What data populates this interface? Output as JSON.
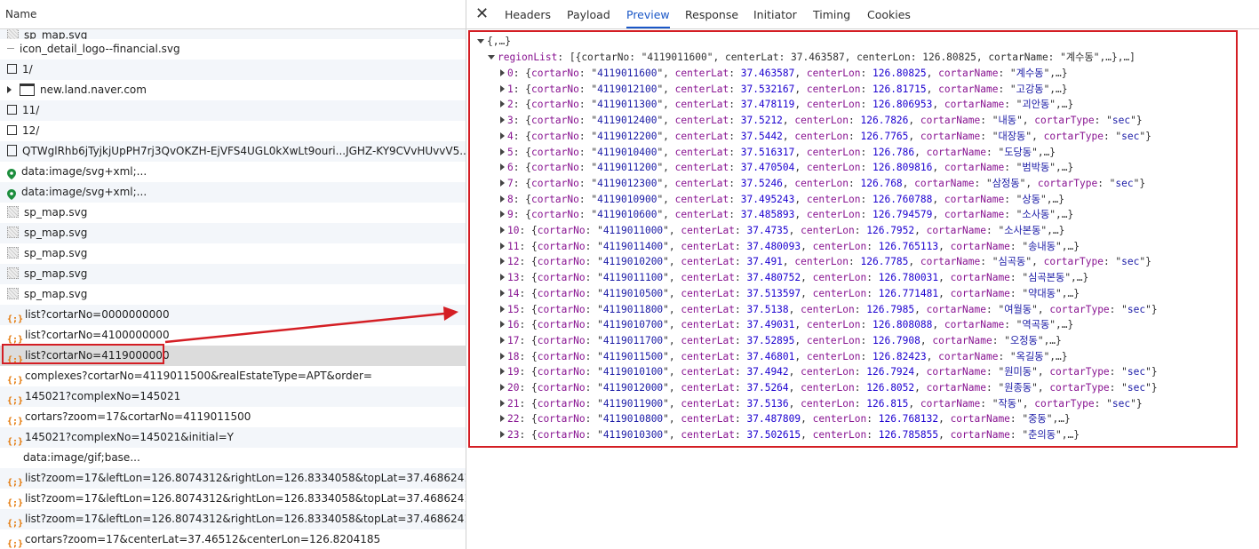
{
  "left_panel": {
    "column_header": "Name",
    "requests": [
      {
        "label": "sp_map.svg",
        "icon": "svg-image-icon"
      },
      {
        "label": "icon_detail_logo--financial.svg",
        "icon": "dash-icon"
      },
      {
        "label": "1/",
        "icon": "document-icon"
      },
      {
        "label": "new.land.naver.com",
        "icon": "frame-icon"
      },
      {
        "label": "11/",
        "icon": "document-icon"
      },
      {
        "label": "12/",
        "icon": "document-icon"
      },
      {
        "label": "QTWglRhb6jTyjkjUpPH7rj3QvOKZH-EjVFS4UGL0kXwLt9ouri...JGHZ-KY9CVvHUvvV5...",
        "icon": "file-icon"
      },
      {
        "label": "data:image/svg+xml;...",
        "icon": "map-pin-icon"
      },
      {
        "label": "data:image/svg+xml;...",
        "icon": "map-pin-icon"
      },
      {
        "label": "sp_map.svg",
        "icon": "svg-image-icon"
      },
      {
        "label": "sp_map.svg",
        "icon": "svg-image-icon"
      },
      {
        "label": "sp_map.svg",
        "icon": "svg-image-icon"
      },
      {
        "label": "sp_map.svg",
        "icon": "svg-image-icon"
      },
      {
        "label": "sp_map.svg",
        "icon": "svg-image-icon"
      },
      {
        "label": "list?cortarNo=0000000000",
        "icon": "json-icon"
      },
      {
        "label": "list?cortarNo=4100000000",
        "icon": "json-icon"
      },
      {
        "label": "list?cortarNo=4119000000",
        "icon": "json-icon"
      },
      {
        "label": "complexes?cortarNo=4119011500&realEstateType=APT&order=",
        "icon": "json-icon"
      },
      {
        "label": "145021?complexNo=145021",
        "icon": "json-icon"
      },
      {
        "label": "cortars?zoom=17&cortarNo=4119011500",
        "icon": "json-icon"
      },
      {
        "label": "145021?complexNo=145021&initial=Y",
        "icon": "json-icon"
      },
      {
        "label": "data:image/gif;base...",
        "icon": "none"
      },
      {
        "label": "list?zoom=17&leftLon=126.8074312&rightLon=126.8334058&topLat=37.4686241...",
        "icon": "json-icon"
      },
      {
        "label": "list?zoom=17&leftLon=126.8074312&rightLon=126.8334058&topLat=37.4686241...",
        "icon": "json-icon"
      },
      {
        "label": "list?zoom=17&leftLon=126.8074312&rightLon=126.8334058&topLat=37.4686241...",
        "icon": "json-icon"
      },
      {
        "label": "cortars?zoom=17&centerLat=37.46512&centerLon=126.8204185",
        "icon": "json-icon"
      }
    ]
  },
  "tabs": [
    {
      "label": "Headers"
    },
    {
      "label": "Payload"
    },
    {
      "label": "Preview",
      "active": true
    },
    {
      "label": "Response"
    },
    {
      "label": "Initiator"
    },
    {
      "label": "Timing"
    },
    {
      "label": "Cookies"
    }
  ],
  "preview": {
    "root": "{,…}",
    "region_key": "regionList",
    "region_summary": "[{cortarNo: \"4119011600\", centerLat: 37.463587, centerLon: 126.80825, cortarName: \"계수동\",…},…]",
    "items": [
      {
        "i": "0",
        "cortarNo": "4119011600",
        "centerLat": "37.463587",
        "centerLon": "126.80825",
        "cortarName": "계수동",
        "cortarType": null
      },
      {
        "i": "1",
        "cortarNo": "4119012100",
        "centerLat": "37.532167",
        "centerLon": "126.81715",
        "cortarName": "고강동",
        "cortarType": null
      },
      {
        "i": "2",
        "cortarNo": "4119011300",
        "centerLat": "37.478119",
        "centerLon": "126.806953",
        "cortarName": "괴안동",
        "cortarType": null
      },
      {
        "i": "3",
        "cortarNo": "4119012400",
        "centerLat": "37.5212",
        "centerLon": "126.7826",
        "cortarName": "내동",
        "cortarType": "sec"
      },
      {
        "i": "4",
        "cortarNo": "4119012200",
        "centerLat": "37.5442",
        "centerLon": "126.7765",
        "cortarName": "대장동",
        "cortarType": "sec"
      },
      {
        "i": "5",
        "cortarNo": "4119010400",
        "centerLat": "37.516317",
        "centerLon": "126.786",
        "cortarName": "도당동",
        "cortarType": null
      },
      {
        "i": "6",
        "cortarNo": "4119011200",
        "centerLat": "37.470504",
        "centerLon": "126.809816",
        "cortarName": "범박동",
        "cortarType": null
      },
      {
        "i": "7",
        "cortarNo": "4119012300",
        "centerLat": "37.5246",
        "centerLon": "126.768",
        "cortarName": "삼정동",
        "cortarType": "sec"
      },
      {
        "i": "8",
        "cortarNo": "4119010900",
        "centerLat": "37.495243",
        "centerLon": "126.760788",
        "cortarName": "상동",
        "cortarType": null
      },
      {
        "i": "9",
        "cortarNo": "4119010600",
        "centerLat": "37.485893",
        "centerLon": "126.794579",
        "cortarName": "소사동",
        "cortarType": null
      },
      {
        "i": "10",
        "cortarNo": "4119011000",
        "centerLat": "37.4735",
        "centerLon": "126.7952",
        "cortarName": "소사본동",
        "cortarType": null
      },
      {
        "i": "11",
        "cortarNo": "4119011400",
        "centerLat": "37.480093",
        "centerLon": "126.765113",
        "cortarName": "송내동",
        "cortarType": null
      },
      {
        "i": "12",
        "cortarNo": "4119010200",
        "centerLat": "37.491",
        "centerLon": "126.7785",
        "cortarName": "심곡동",
        "cortarType": "sec"
      },
      {
        "i": "13",
        "cortarNo": "4119011100",
        "centerLat": "37.480752",
        "centerLon": "126.780031",
        "cortarName": "심곡본동",
        "cortarType": null
      },
      {
        "i": "14",
        "cortarNo": "4119010500",
        "centerLat": "37.513597",
        "centerLon": "126.771481",
        "cortarName": "약대동",
        "cortarType": null
      },
      {
        "i": "15",
        "cortarNo": "4119011800",
        "centerLat": "37.5138",
        "centerLon": "126.7985",
        "cortarName": "여월동",
        "cortarType": "sec"
      },
      {
        "i": "16",
        "cortarNo": "4119010700",
        "centerLat": "37.49031",
        "centerLon": "126.808088",
        "cortarName": "역곡동",
        "cortarType": null
      },
      {
        "i": "17",
        "cortarNo": "4119011700",
        "centerLat": "37.52895",
        "centerLon": "126.7908",
        "cortarName": "오정동",
        "cortarType": null
      },
      {
        "i": "18",
        "cortarNo": "4119011500",
        "centerLat": "37.46801",
        "centerLon": "126.82423",
        "cortarName": "옥길동",
        "cortarType": null
      },
      {
        "i": "19",
        "cortarNo": "4119010100",
        "centerLat": "37.4942",
        "centerLon": "126.7924",
        "cortarName": "원미동",
        "cortarType": "sec"
      },
      {
        "i": "20",
        "cortarNo": "4119012000",
        "centerLat": "37.5264",
        "centerLon": "126.8052",
        "cortarName": "원종동",
        "cortarType": "sec"
      },
      {
        "i": "21",
        "cortarNo": "4119011900",
        "centerLat": "37.5136",
        "centerLon": "126.815",
        "cortarName": "작동",
        "cortarType": "sec"
      },
      {
        "i": "22",
        "cortarNo": "4119010800",
        "centerLat": "37.487809",
        "centerLon": "126.768132",
        "cortarName": "중동",
        "cortarType": null
      },
      {
        "i": "23",
        "cortarNo": "4119010300",
        "centerLat": "37.502615",
        "centerLon": "126.785855",
        "cortarName": "춘의동",
        "cortarType": null
      }
    ]
  },
  "colors": {
    "highlight_red": "#d41e24",
    "active_tab_blue": "#1a57c7",
    "json_key_purple": "#881391",
    "json_string_blue": "#1a1aa6",
    "json_icon_orange": "#e37400",
    "map_pin_green": "#1e8e3e"
  }
}
